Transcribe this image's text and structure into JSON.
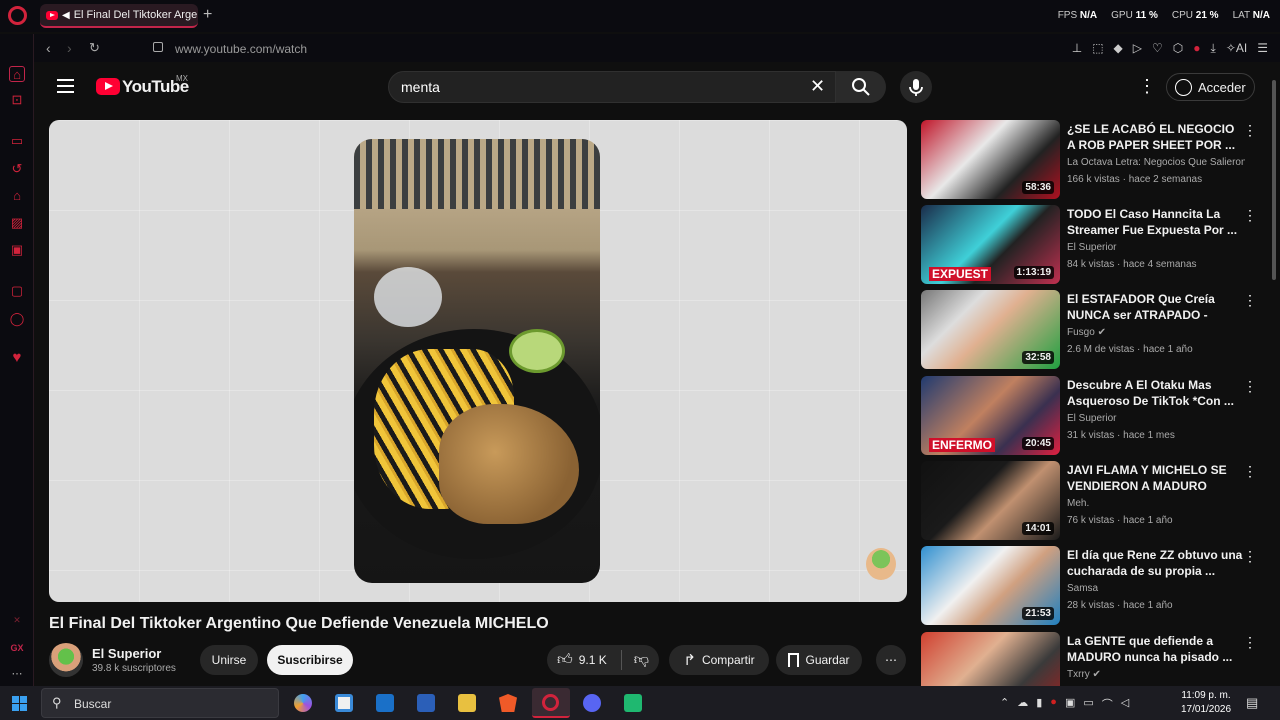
{
  "browser": {
    "tab_title": "El Final Del Tiktoker Argentino Que Defiende Venezuela MICHELO",
    "new_tab": "+",
    "url": "www.youtube.com/watch",
    "stats": [
      {
        "label": "FPS",
        "value": "N/A"
      },
      {
        "label": "GPU",
        "value": "11 %"
      },
      {
        "label": "CPU",
        "value": "21 %"
      },
      {
        "label": "LAT",
        "value": "N/A"
      }
    ],
    "ext_ai": "AI",
    "sidebar_bottom": "GX",
    "accent": "#d2233c"
  },
  "youtube": {
    "logo_text": "YouTube",
    "region": "MX",
    "search_value": "menta",
    "signin_label": "Acceder"
  },
  "video": {
    "title": "El Final Del Tiktoker Argentino Que Defiende Venezuela MICHELO",
    "channel": "El Superior",
    "subscribers": "39.8 k suscriptores",
    "join_label": "Unirse",
    "subscribe_label": "Suscribirse",
    "likes": "9.1 K",
    "share_label": "Compartir",
    "save_label": "Guardar"
  },
  "recommendations": [
    {
      "title": "¿SE LE ACABÓ EL NEGOCIO A ROB PAPER SHEET POR ...",
      "channel": "La Octava Letra: Negocios Que Salieron ...",
      "meta": "166 k vistas · hace 2 semanas",
      "duration": "58:36",
      "banner": "",
      "thumb": "linear-gradient(135deg,#c0162a,#e8e8e8 40%,#222 70%,#b01020)"
    },
    {
      "title": "TODO El Caso Hanncita La Streamer Fue Expuesta Por ...",
      "channel": "El Superior",
      "meta": "84 k vistas · hace 4 semanas",
      "duration": "1:13:19",
      "banner": "EXPUEST",
      "thumb": "linear-gradient(135deg,#1a2c4a,#3fd0d8 45%,#222 60%,#c03050)"
    },
    {
      "title": "El ESTAFADOR Que Creía NUNCA ser ATRAPADO - Caso...",
      "channel": "Fusgo ✔",
      "meta": "2.6 M de vistas · hace 1 año",
      "duration": "32:58",
      "banner": "",
      "thumb": "linear-gradient(135deg,#777,#ddd 30%,#e0b090 50%,#1fa040)"
    },
    {
      "title": "Descubre A El Otaku Mas Asqueroso De TikTok *Con ...",
      "channel": "El Superior",
      "meta": "31 k vistas · hace 1 mes",
      "duration": "20:45",
      "banner": "ENFERMO",
      "thumb": "linear-gradient(135deg,#203a70,#c08060 45%,#3a3050 70%,#e02040)"
    },
    {
      "title": "JAVI FLAMA Y MICHELO SE VENDIERON A MADURO",
      "channel": "Meh.",
      "meta": "76 k vistas · hace 1 año",
      "duration": "14:01",
      "banner": "",
      "thumb": "linear-gradient(135deg,#111,#1a1a1a 40%,#c09070 60%,#1a1a1a)"
    },
    {
      "title": "El día que Rene ZZ obtuvo una cucharada de su propia ...",
      "channel": "Samsa",
      "meta": "28 k vistas · hace 1 año",
      "duration": "21:53",
      "banner": "",
      "thumb": "linear-gradient(135deg,#3090d0,#f0f0f0 40%,#d0a080 60%,#2080c0)"
    },
    {
      "title": "La GENTE que defiende a MADURO nunca ha pisado ...",
      "channel": "Txrry ✔",
      "meta": "",
      "duration": "",
      "banner": "",
      "thumb": "linear-gradient(135deg,#d04030,#e0b090 40%,#3a3a3a 70%,#a02020)"
    }
  ],
  "taskbar": {
    "search_placeholder": "Buscar",
    "time": "11:09 p. m.",
    "date": "17/01/2026"
  }
}
